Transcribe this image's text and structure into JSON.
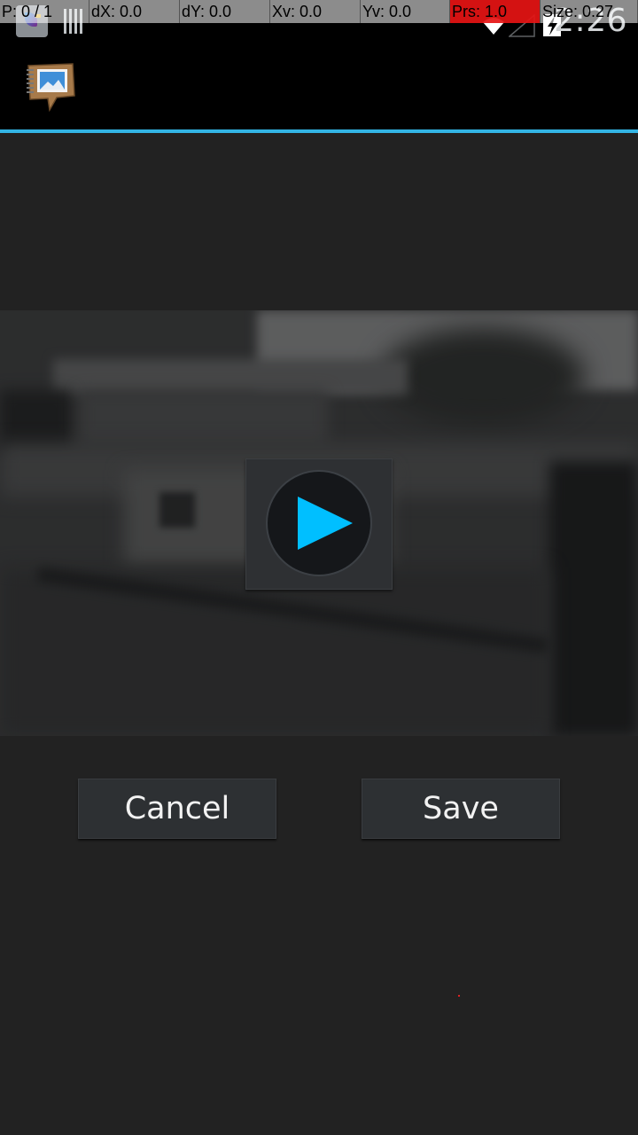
{
  "overlay": {
    "pointer": "P: 0 / 1",
    "dx": "dX: 0.0",
    "dy": "dY: 0.0",
    "xv": "Xv: 0.0",
    "yv": "Yv: 0.0",
    "prs": "Prs: 1.0",
    "size": "Size: 0.27"
  },
  "status_bar": {
    "time": "2:26",
    "icons": [
      "notification-app-icon",
      "bars-icon",
      "wifi-icon",
      "signal-icon",
      "battery-icon"
    ]
  },
  "action_bar": {
    "logo_icon": "album-notebook-icon",
    "accent_color": "#33b5e5"
  },
  "video": {
    "play_icon": "play-icon",
    "play_color": "#00bfff"
  },
  "buttons": {
    "cancel_label": "Cancel",
    "save_label": "Save"
  }
}
